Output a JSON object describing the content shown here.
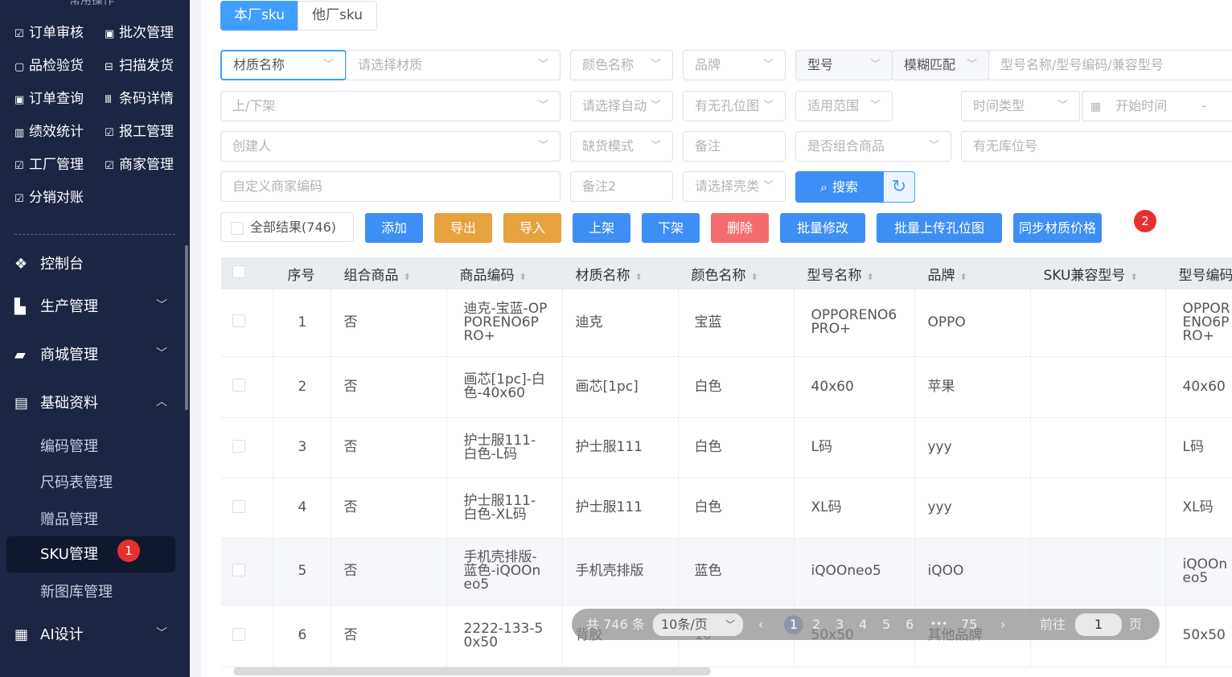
{
  "sidebar": {
    "top_label": "常用操作",
    "quick": [
      {
        "icon": "☑",
        "label": "订单审核"
      },
      {
        "icon": "▣",
        "label": "批次管理"
      },
      {
        "icon": "▢",
        "label": "品检验货"
      },
      {
        "icon": "⊟",
        "label": "扫描发货"
      },
      {
        "icon": "▣",
        "label": "订单查询"
      },
      {
        "icon": "Ⅲ",
        "label": "条码详情"
      },
      {
        "icon": "▥",
        "label": "绩效统计"
      },
      {
        "icon": "☑",
        "label": "报工管理"
      },
      {
        "icon": "☑",
        "label": "工厂管理"
      },
      {
        "icon": "☑",
        "label": "商家管理"
      },
      {
        "icon": "☑",
        "label": "分销对账"
      }
    ],
    "menus": [
      {
        "icon": "❖",
        "label": "控制台"
      },
      {
        "icon": "▙",
        "label": "生产管理"
      },
      {
        "icon": "▰",
        "label": "商城管理"
      },
      {
        "icon": "▤",
        "label": "基础资料"
      },
      {
        "icon": "▦",
        "label": "AI设计"
      }
    ],
    "submenu": [
      "编码管理",
      "尺码表管理",
      "赠品管理",
      "SKU管理",
      "新图库管理"
    ],
    "active_badge": "1"
  },
  "tabs": [
    "本厂sku",
    "他厂sku"
  ],
  "filters": {
    "material_type": "材质名称",
    "material_select": "请选择材质",
    "color": "颜色名称",
    "brand": "品牌",
    "model": "型号",
    "match": "模糊匹配",
    "model_search": "型号名称/型号编码/兼容型号",
    "shelf": "上/下架",
    "auto": "请选择自动",
    "hole": "有无孔位图",
    "scope": "适用范围",
    "time_type": "时间类型",
    "start_time": "开始时间",
    "dash": "-",
    "creator": "创建人",
    "stockout": "缺货模式",
    "remark": "备注",
    "combo": "是否组合商品",
    "location": "有无库位号",
    "merchant_code": "自定义商家编码",
    "remark2": "备注2",
    "case": "请选择壳类",
    "search": "搜索"
  },
  "actions": {
    "all_results": "全部结果(746)",
    "add": "添加",
    "export": "导出",
    "import": "导入",
    "up": "上架",
    "down": "下架",
    "delete": "删除",
    "batch_edit": "批量修改",
    "batch_upload": "批量上传孔位图",
    "sync_price": "同步材质价格",
    "badge": "2"
  },
  "table": {
    "headers": [
      "序号",
      "组合商品",
      "商品编码",
      "材质名称",
      "颜色名称",
      "型号名称",
      "品牌",
      "SKU兼容型号",
      "型号编码"
    ],
    "rows": [
      [
        "1",
        "否",
        "迪克-宝蓝-OPPORENO6PRO+",
        "迪克",
        "宝蓝",
        "OPPORENO6PRO+",
        "OPPO",
        "",
        "OPPORENO6PRO+"
      ],
      [
        "2",
        "否",
        "画芯[1pc]-白色-40x60",
        "画芯[1pc]",
        "白色",
        "40x60",
        "苹果",
        "",
        "40x60"
      ],
      [
        "3",
        "否",
        "护士服111-白色-L码",
        "护士服111",
        "白色",
        "L码",
        "yyy",
        "",
        "L码"
      ],
      [
        "4",
        "否",
        "护士服111-白色-XL码",
        "护士服111",
        "白色",
        "XL码",
        "yyy",
        "",
        "XL码"
      ],
      [
        "5",
        "否",
        "手机壳排版-蓝色-iQOOneo5",
        "手机壳排版",
        "蓝色",
        "iQOOneo5",
        "iQOO",
        "",
        "iQOOneo5"
      ],
      [
        "6",
        "否",
        "2222-133-50x50",
        "背胶",
        "10",
        "50x50",
        "其他品牌",
        "",
        "50x50"
      ]
    ]
  },
  "pager": {
    "total": "共 746 条",
    "size": "10条/页",
    "prev": "‹",
    "pages": [
      "1",
      "2",
      "3",
      "4",
      "5",
      "6",
      "•••",
      "75"
    ],
    "next": "›",
    "goto": "前往",
    "page_input": "1",
    "page_unit": "页"
  }
}
